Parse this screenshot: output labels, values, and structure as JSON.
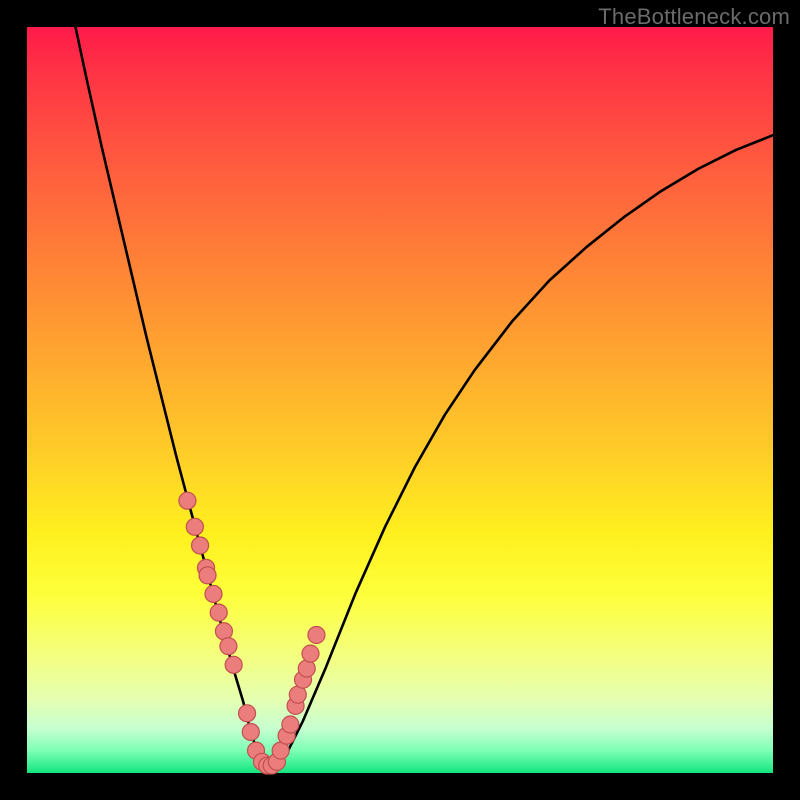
{
  "watermark": "TheBottleneck.com",
  "chart_data": {
    "type": "line",
    "title": "",
    "xlabel": "",
    "ylabel": "",
    "xlim": [
      0,
      100
    ],
    "ylim": [
      0,
      100
    ],
    "grid": false,
    "legend": false,
    "background_gradient": {
      "top": "#ff1a4a",
      "bottom": "#13e57e"
    },
    "series": [
      {
        "name": "bottleneck-curve",
        "color": "#000000",
        "x": [
          6.5,
          8,
          10,
          12,
          14,
          16,
          18,
          20,
          22,
          24,
          26,
          27.5,
          29,
          30,
          31,
          32,
          33,
          35,
          37,
          40,
          44,
          48,
          52,
          56,
          60,
          65,
          70,
          75,
          80,
          85,
          90,
          95,
          100
        ],
        "y": [
          100,
          93,
          84,
          75.5,
          67,
          58.5,
          50.5,
          42.5,
          35,
          27.5,
          20,
          14.5,
          9.5,
          5.5,
          2.5,
          1,
          1,
          3,
          7,
          14,
          24,
          33,
          41,
          48,
          54,
          60.5,
          66,
          70.5,
          74.5,
          78,
          81,
          83.5,
          85.5
        ]
      }
    ],
    "markers": {
      "name": "highlight-points",
      "color": "#eb7d7d",
      "x": [
        21.5,
        22.5,
        23.2,
        24,
        24.2,
        25,
        25.7,
        26.4,
        27,
        27.7,
        29.5,
        30,
        30.7,
        31.5,
        32.2,
        32.8,
        33.5,
        34,
        34.8,
        35.3,
        36,
        36.3,
        37,
        37.5,
        38,
        38.8
      ],
      "y": [
        36.5,
        33,
        30.5,
        27.5,
        26.5,
        24,
        21.5,
        19,
        17,
        14.5,
        8,
        5.5,
        3,
        1.5,
        1,
        1,
        1.5,
        3,
        5,
        6.5,
        9,
        10.5,
        12.5,
        14,
        16,
        18.5
      ]
    }
  }
}
